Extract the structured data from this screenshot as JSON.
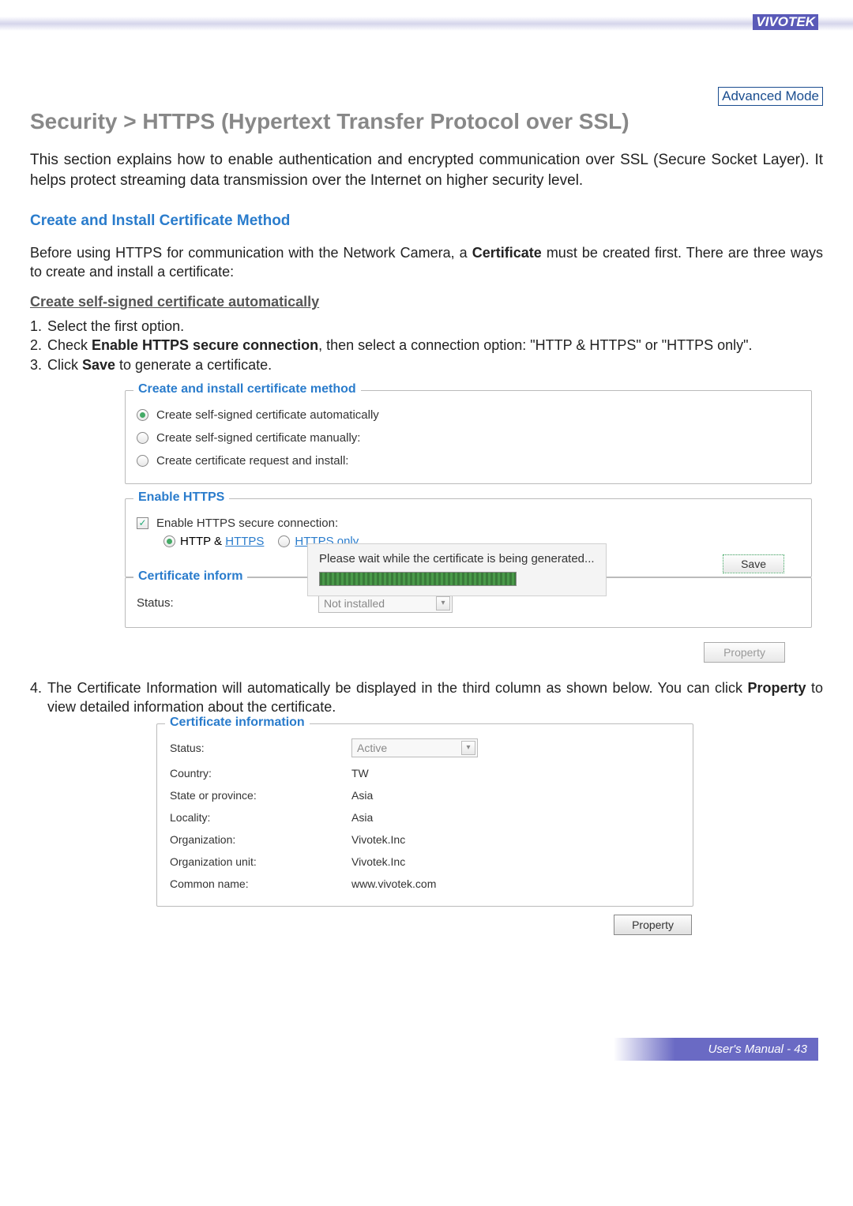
{
  "brand": "VIVOTEK",
  "badge": "Advanced Mode",
  "title": "Security >  HTTPS (Hypertext Transfer Protocol over SSL)",
  "intro": "This section explains how to enable authentication and encrypted communication over SSL (Secure Socket Layer). It helps protect streaming data transmission over the Internet on higher security level.",
  "subhead": "Create and Install Certificate Method",
  "before_text_1": "Before using HTTPS for communication with the Network Camera, a ",
  "before_bold": "Certificate",
  "before_text_2": " must be created first. There are three ways to create and install a certificate:",
  "underline_head": "Create self-signed certificate automatically",
  "step1": "Select the first option.",
  "step2_a": "Check ",
  "step2_b": "Enable HTTPS secure connection",
  "step2_c": ", then select a connection option: \"HTTP & HTTPS\" or \"HTTPS only\".",
  "step3_a": "Click ",
  "step3_b": "Save",
  "step3_c": " to generate a certificate.",
  "panel1": {
    "legend": "Create and install certificate method",
    "r1": "Create self-signed certificate automatically",
    "r2": "Create self-signed certificate manually:",
    "r3": "Create certificate request and install:"
  },
  "panel2": {
    "legend": "Enable HTTPS",
    "check": "Enable HTTPS secure connection:",
    "opt_a_pre": "HTTP & ",
    "opt_a_link": "HTTPS",
    "opt_b": "HTTPS only",
    "wait": "Please wait while the certificate is being generated...",
    "save": "Save"
  },
  "panel3": {
    "legend": "Certificate inform",
    "status_lbl": "Status:",
    "status_val": "Not installed",
    "property": "Property"
  },
  "step4_a": "The Certificate Information will automatically be displayed in the third column as shown below. You can click ",
  "step4_b": "Property",
  "step4_c": " to view detailed information about the certificate.",
  "certinfo": {
    "legend": "Certificate information",
    "rows": [
      {
        "lbl": "Status:",
        "val": "Active",
        "select": true
      },
      {
        "lbl": "Country:",
        "val": "TW"
      },
      {
        "lbl": "State or province:",
        "val": "Asia"
      },
      {
        "lbl": "Locality:",
        "val": "Asia"
      },
      {
        "lbl": "Organization:",
        "val": "Vivotek.Inc"
      },
      {
        "lbl": "Organization unit:",
        "val": "Vivotek.Inc"
      },
      {
        "lbl": "Common name:",
        "val": "www.vivotek.com"
      }
    ],
    "property": "Property"
  },
  "footer": "User's Manual - 43"
}
